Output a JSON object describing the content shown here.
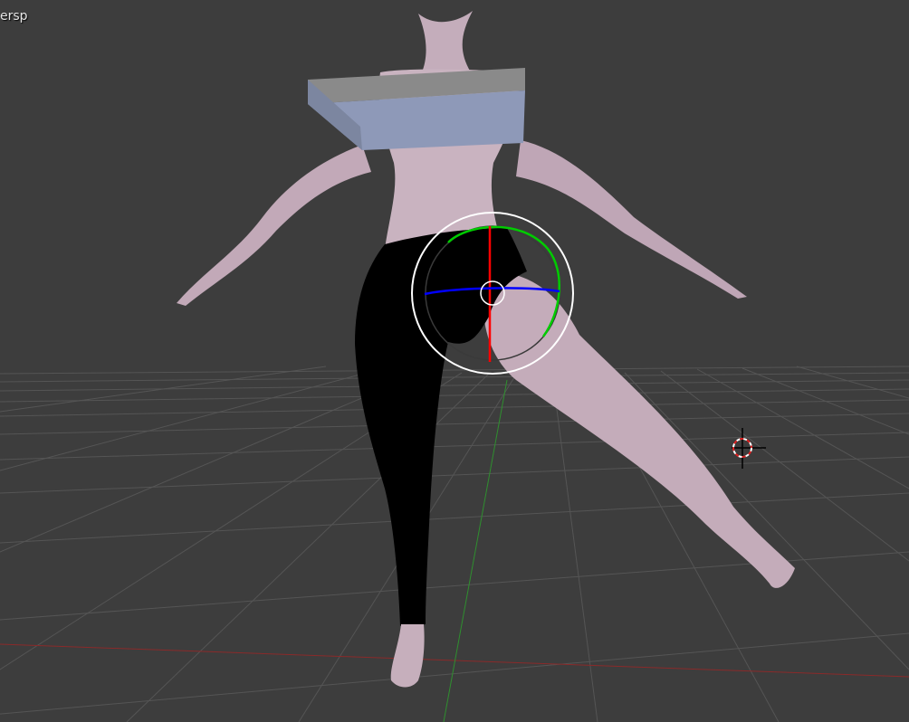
{
  "viewport": {
    "view_label": "ersp"
  },
  "scene": {
    "background_color": "#3d3d3d",
    "grid_color": "#555555",
    "x_axis_color": "#8a2a2a",
    "y_axis_color": "#2f8f2f",
    "skin_color": "#c9b3c0",
    "pants_color": "#000000",
    "box_top_color": "#8a8a8a",
    "box_front_color": "#8e99b8",
    "gizmo_colors": {
      "x_ring": "#ff0000",
      "y_ring": "#00cc00",
      "z_ring": "#0000ff",
      "view_ring": "#ffffff"
    },
    "objects": [
      "human-mesh",
      "box-mesh",
      "rotate-gizmo",
      "3d-cursor"
    ]
  }
}
